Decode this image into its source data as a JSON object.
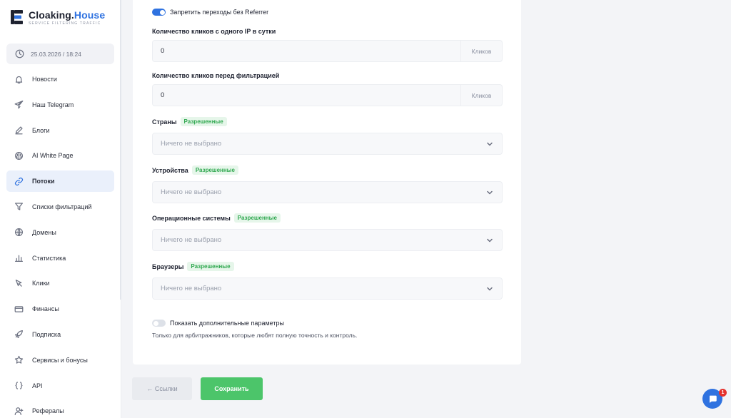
{
  "brand": {
    "name_main": "Cloaking.",
    "name_accent": "House",
    "tagline": "SERVICE FILTERING TRAFFIC",
    "accent_color": "#2f72e0"
  },
  "sidebar": {
    "datetime": "25.03.2026 / 18:24",
    "items": [
      {
        "label": "Новости",
        "icon": "bell-icon"
      },
      {
        "label": "Наш Telegram",
        "icon": "telegram-icon"
      },
      {
        "label": "Блоги",
        "icon": "pen-icon"
      },
      {
        "label": "AI White Page",
        "icon": "brain-icon"
      },
      {
        "label": "Потоки",
        "icon": "link-icon",
        "active": true
      },
      {
        "label": "Списки фильтраций",
        "icon": "filter-icon"
      },
      {
        "label": "Домены",
        "icon": "globe-icon"
      },
      {
        "label": "Статистика",
        "icon": "chart-icon"
      },
      {
        "label": "Клики",
        "icon": "cursor-icon"
      },
      {
        "label": "Финансы",
        "icon": "card-icon"
      },
      {
        "label": "Подписка",
        "icon": "rocket-icon"
      },
      {
        "label": "Сервисы и бонусы",
        "icon": "star-icon"
      },
      {
        "label": "API",
        "icon": "braces-icon"
      },
      {
        "label": "Рефералы",
        "icon": "user-plus-icon"
      }
    ]
  },
  "form": {
    "referrer_toggle": {
      "label": "Запретить переходы без Referrer",
      "on": true
    },
    "clicks_per_ip": {
      "label": "Количество кликов с одного IP в сутки",
      "value": "0",
      "unit": "Кликов"
    },
    "clicks_before_filter": {
      "label": "Количество кликов перед фильтрацией",
      "value": "0",
      "unit": "Кликов"
    },
    "countries": {
      "label": "Страны",
      "badge": "Разрешенные",
      "placeholder": "Ничего не выбрано"
    },
    "devices": {
      "label": "Устройства",
      "badge": "Разрешенные",
      "placeholder": "Ничего не выбрано"
    },
    "os": {
      "label": "Операционные системы",
      "badge": "Разрешенные",
      "placeholder": "Ничего не выбрано"
    },
    "browsers": {
      "label": "Браузеры",
      "badge": "Разрешенные",
      "placeholder": "Ничего не выбрано"
    },
    "advanced_toggle": {
      "label": "Показать дополнительные параметры",
      "on": false
    },
    "advanced_hint": "Только для арбитражников, которые любят полную точность и контроль."
  },
  "actions": {
    "back_label": "← Ссылки",
    "save_label": "Сохранить"
  },
  "chat": {
    "unread": "1"
  }
}
